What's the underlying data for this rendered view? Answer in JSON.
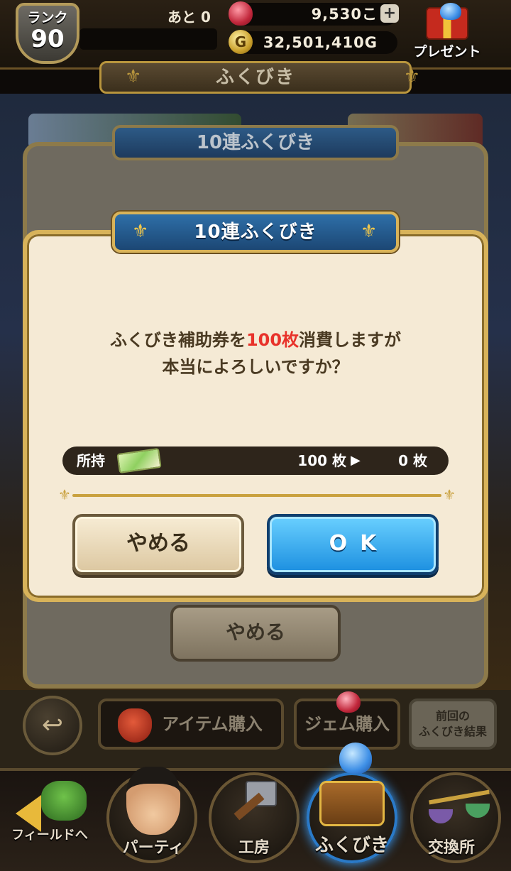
{
  "header": {
    "rank_label": "ランク",
    "rank_value": "90",
    "remaining_label": "あと 0",
    "gems": "9,530こ",
    "gold": "32,501,410G",
    "gold_icon_glyph": "G",
    "plus_glyph": "+",
    "present_label": "プレゼント",
    "screen_title": "ふくびき"
  },
  "background": {
    "panel_title": "10連ふくびき",
    "cancel_label": "やめる"
  },
  "dialog": {
    "title": "10連ふくびき",
    "message_part1": "ふくびき補助券を",
    "message_highlight": "100枚",
    "message_part2": "消費しますが",
    "message_line2": "本当によろしいですか？",
    "owned_label": "所持",
    "owned_before": "100 枚",
    "owned_after": "0 枚",
    "cancel_label": "やめる",
    "ok_label": "OK"
  },
  "footer": {
    "item_buy_label": "アイテム購入",
    "gem_buy_label": "ジェム購入",
    "prev_result_line1": "前回の",
    "prev_result_line2": "ふくびき結果"
  },
  "nav": {
    "items": [
      {
        "label": "フィールドへ"
      },
      {
        "label": "パーティ"
      },
      {
        "label": "工房"
      },
      {
        "label": "ふくびき"
      },
      {
        "label": "交換所"
      }
    ]
  },
  "colors": {
    "highlight": "#e8322a",
    "ok_button": "#1c8fe0",
    "dialog_bg": "#f5ead5",
    "gold_frame": "#d8b35a"
  }
}
